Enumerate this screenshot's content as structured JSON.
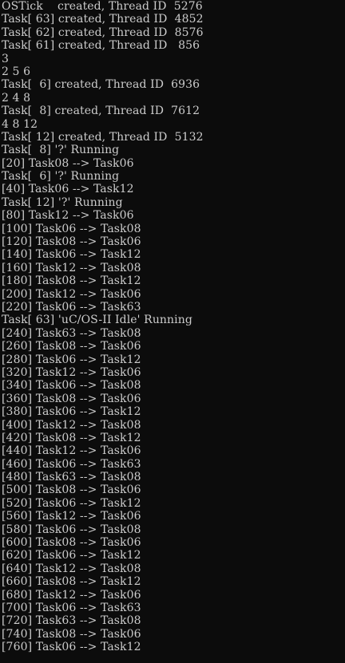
{
  "console": {
    "lines": [
      "OSTick    created, Thread ID  5276",
      "Task[ 63] created, Thread ID  4852",
      "Task[ 62] created, Thread ID  8576",
      "Task[ 61] created, Thread ID   856",
      "3",
      "2 5 6",
      "Task[  6] created, Thread ID  6936",
      "2 4 8",
      "Task[  8] created, Thread ID  7612",
      "4 8 12",
      "Task[ 12] created, Thread ID  5132",
      "Task[  8] '?' Running",
      "[20] Task08 --> Task06",
      "Task[  6] '?' Running",
      "[40] Task06 --> Task12",
      "Task[ 12] '?' Running",
      "[80] Task12 --> Task06",
      "[100] Task06 --> Task08",
      "[120] Task08 --> Task06",
      "[140] Task06 --> Task12",
      "[160] Task12 --> Task08",
      "[180] Task08 --> Task12",
      "[200] Task12 --> Task06",
      "[220] Task06 --> Task63",
      "Task[ 63] 'uC/OS-II Idle' Running",
      "[240] Task63 --> Task08",
      "[260] Task08 --> Task06",
      "[280] Task06 --> Task12",
      "[320] Task12 --> Task06",
      "[340] Task06 --> Task08",
      "[360] Task08 --> Task06",
      "[380] Task06 --> Task12",
      "[400] Task12 --> Task08",
      "[420] Task08 --> Task12",
      "[440] Task12 --> Task06",
      "[460] Task06 --> Task63",
      "[480] Task63 --> Task08",
      "[500] Task08 --> Task06",
      "[520] Task06 --> Task12",
      "[560] Task12 --> Task06",
      "[580] Task06 --> Task08",
      "[600] Task08 --> Task06",
      "[620] Task06 --> Task12",
      "[640] Task12 --> Task08",
      "[660] Task08 --> Task12",
      "[680] Task12 --> Task06",
      "[700] Task06 --> Task63",
      "[720] Task63 --> Task08",
      "[740] Task08 --> Task06",
      "[760] Task06 --> Task12"
    ]
  },
  "colors": {
    "background": "#0c0c0c",
    "text": "#cccccc"
  }
}
